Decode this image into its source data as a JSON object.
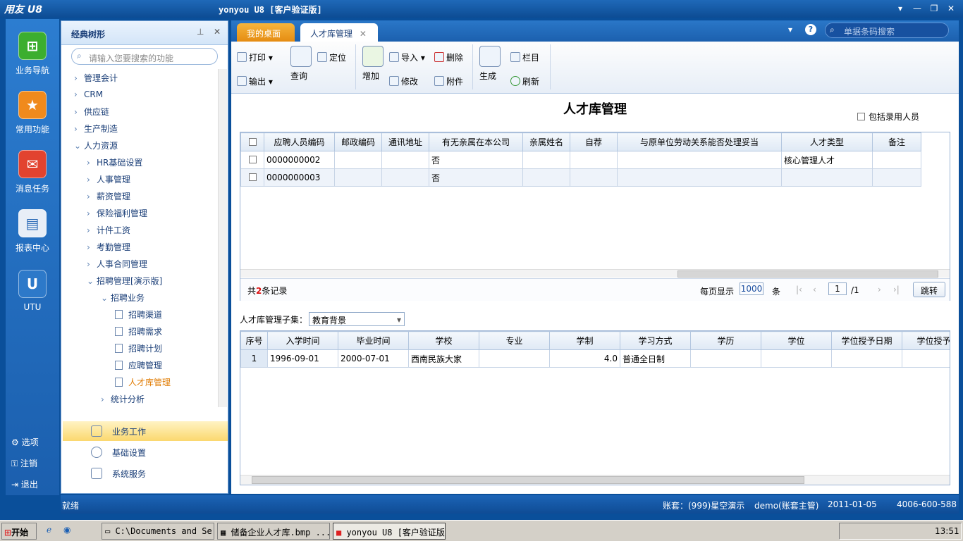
{
  "app": {
    "logo": "用友 U8",
    "title": "yonyou U8 [客户验证版]"
  },
  "window_buttons": [
    "▾",
    "—",
    "❐",
    "✕"
  ],
  "leftnav": {
    "apps": [
      {
        "label": "业务导航",
        "icon": "business-nav-icon"
      },
      {
        "label": "常用功能",
        "icon": "star-icon"
      },
      {
        "label": "消息任务",
        "icon": "message-icon"
      },
      {
        "label": "报表中心",
        "icon": "report-icon"
      },
      {
        "label": "UTU",
        "icon": "utu-icon"
      }
    ],
    "bottom": [
      {
        "label": "选项",
        "icon": "gear-icon"
      },
      {
        "label": "注销",
        "icon": "key-icon"
      },
      {
        "label": "退出",
        "icon": "exit-icon"
      }
    ]
  },
  "tree": {
    "title": "经典树形",
    "search_placeholder": "请输入您要搜索的功能",
    "items": [
      "管理会计",
      "CRM",
      "供应链",
      "生产制造",
      "人力资源",
      "HR基础设置",
      "人事管理",
      "薪资管理",
      "保险福利管理",
      "计件工资",
      "考勤管理",
      "人事合同管理",
      "招聘管理[演示版]",
      "招聘业务",
      "招聘渠道",
      "招聘需求",
      "招聘计划",
      "应聘管理",
      "人才库管理",
      "统计分析"
    ],
    "sections": [
      "业务工作",
      "基础设置",
      "系统服务"
    ]
  },
  "tabs": {
    "desktop": "我的桌面",
    "active": "人才库管理",
    "close": "✕"
  },
  "global_search_placeholder": "单据条码搜索",
  "toolbar": {
    "print": "打印",
    "export": "输出",
    "query": "查询",
    "locate": "定位",
    "add": "增加",
    "import": "导入",
    "modify": "修改",
    "delete": "删除",
    "attach": "附件",
    "generate": "生成",
    "columns": "栏目",
    "refresh": "刷新"
  },
  "page": {
    "title": "人才库管理",
    "include_hired": "包括录用人员"
  },
  "grid1": {
    "columns": [
      "应聘人员编码",
      "邮政编码",
      "通讯地址",
      "有无亲属在本公司",
      "亲属姓名",
      "自荐",
      "与原单位劳动关系能否处理妥当",
      "人才类型",
      "备注"
    ],
    "rows": [
      [
        "0000000002",
        "",
        "",
        "否",
        "",
        "",
        "",
        "核心管理人才",
        ""
      ],
      [
        "0000000003",
        "",
        "",
        "否",
        "",
        "",
        "",
        "",
        ""
      ]
    ]
  },
  "pager": {
    "total_prefix": "共",
    "total_count": "2",
    "total_suffix": "条记录",
    "per_page_label": "每页显示",
    "per_page": "1000",
    "unit": "条",
    "page": "1",
    "pages": "/1",
    "jump": "跳转"
  },
  "subset": {
    "label": "人才库管理子集：",
    "selected": "教育背景"
  },
  "grid2": {
    "columns": [
      "序号",
      "入学时间",
      "毕业时间",
      "学校",
      "专业",
      "学制",
      "学习方式",
      "学历",
      "学位",
      "学位授予日期",
      "学位授予单"
    ],
    "rows": [
      [
        "1",
        "1996-09-01",
        "2000-07-01",
        "西南民族大家",
        "",
        "4.0",
        "普通全日制",
        "",
        "",
        "",
        ""
      ]
    ]
  },
  "status": {
    "ready": "就绪",
    "account": "账套：(999)星空演示",
    "user": "demo(账套主管)",
    "date": "2011-01-05",
    "phone": "4006-600-588"
  },
  "taskbar": {
    "start": "开始",
    "tasks": [
      "C:\\Documents and Se...",
      "储备企业人才库.bmp ...",
      "yonyou U8 [客户验证版]"
    ],
    "clock": "13:51"
  }
}
